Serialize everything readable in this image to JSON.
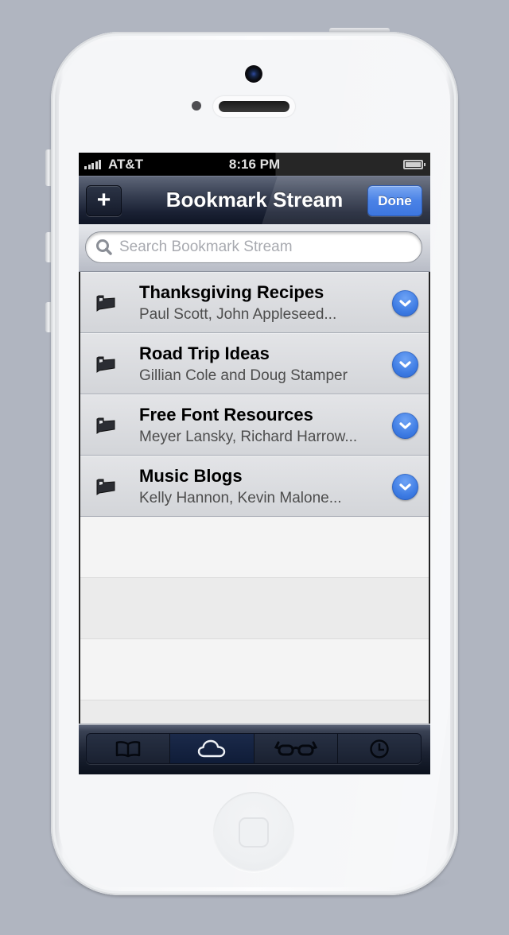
{
  "status_bar": {
    "carrier": "AT&T",
    "time": "8:16 PM",
    "signal_bars": 5,
    "battery_level": 1.0
  },
  "nav_bar": {
    "title": "Bookmark Stream",
    "add_label": "+",
    "done_label": "Done"
  },
  "search": {
    "placeholder": "Search Bookmark Stream",
    "value": ""
  },
  "bookmarks": [
    {
      "title": "Thanksgiving Recipes",
      "subtitle": "Paul Scott, John Appleseed...",
      "icon": "folder-icon"
    },
    {
      "title": "Road Trip Ideas",
      "subtitle": "Gillian Cole and Doug Stamper",
      "icon": "folder-icon"
    },
    {
      "title": "Free Font Resources",
      "subtitle": "Meyer Lansky, Richard Harrow...",
      "icon": "folder-icon"
    },
    {
      "title": "Music Blogs",
      "subtitle": "Kelly Hannon, Kevin Malone...",
      "icon": "folder-icon"
    }
  ],
  "tab_bar": {
    "tabs": [
      {
        "name": "bookmarks",
        "icon": "book-icon",
        "active": false
      },
      {
        "name": "cloud",
        "icon": "cloud-icon",
        "active": true
      },
      {
        "name": "reading-list",
        "icon": "glasses-icon",
        "active": false
      },
      {
        "name": "history",
        "icon": "clock-icon",
        "active": false
      }
    ]
  },
  "colors": {
    "accent_blue": "#4a82e6",
    "nav_dark": "#1a2134",
    "background": "#b0b5c0"
  }
}
